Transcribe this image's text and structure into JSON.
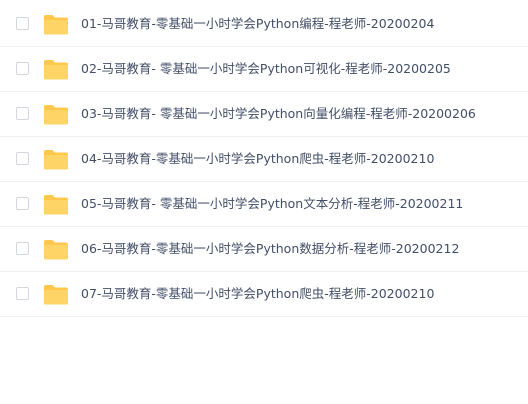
{
  "folder_color": "#FFC84D",
  "files": [
    {
      "name": "01-马哥教育-零基础一小时学会Python编程-程老师-20200204",
      "icon": "folder-icon"
    },
    {
      "name": "02-马哥教育- 零基础一小时学会Python可视化-程老师-20200205",
      "icon": "folder-icon"
    },
    {
      "name": "03-马哥教育- 零基础一小时学会Python向量化编程-程老师-20200206",
      "icon": "folder-icon"
    },
    {
      "name": "04-马哥教育-零基础一小时学会Python爬虫-程老师-20200210",
      "icon": "folder-icon"
    },
    {
      "name": "05-马哥教育- 零基础一小时学会Python文本分析-程老师-20200211",
      "icon": "folder-icon"
    },
    {
      "name": "06-马哥教育-零基础一小时学会Python数据分析-程老师-20200212",
      "icon": "folder-icon"
    },
    {
      "name": "07-马哥教育-零基础一小时学会Python爬虫-程老师-20200210",
      "icon": "folder-icon"
    }
  ]
}
